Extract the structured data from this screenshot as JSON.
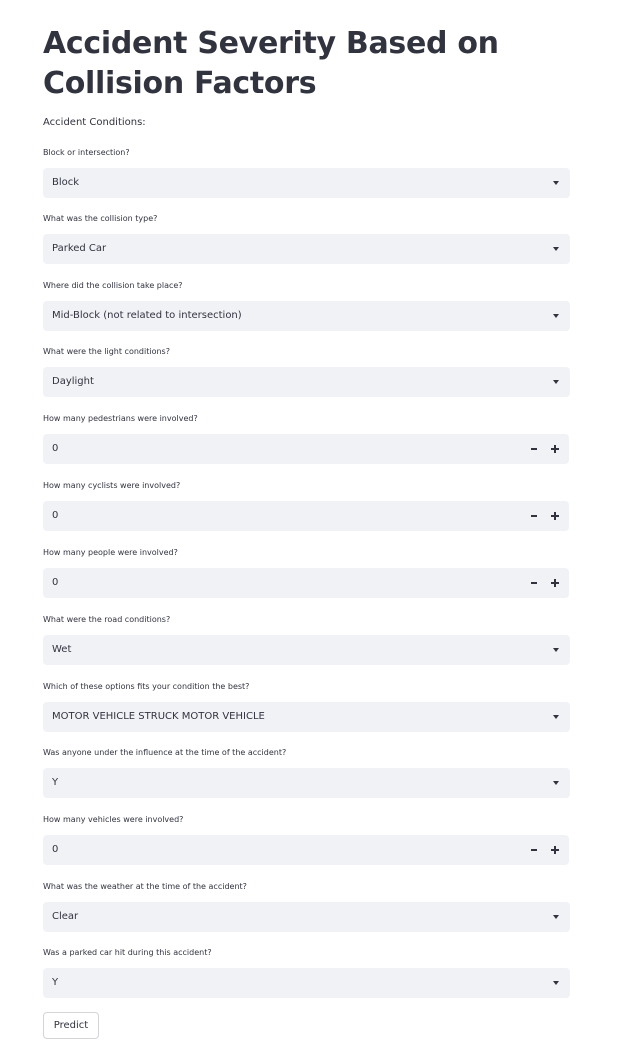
{
  "page": {
    "title": "Accident Severity Based on Collision Factors",
    "subheading": "Accident Conditions:"
  },
  "fields": {
    "block_intersection": {
      "label": "Block or intersection?",
      "value": "Block"
    },
    "collision_type": {
      "label": "What was the collision type?",
      "value": "Parked Car"
    },
    "collision_location": {
      "label": "Where did the collision take place?",
      "value": "Mid-Block (not related to intersection)"
    },
    "light_conditions": {
      "label": "What were the light conditions?",
      "value": "Daylight"
    },
    "pedestrians": {
      "label": "How many pedestrians were involved?",
      "value": "0"
    },
    "cyclists": {
      "label": "How many cyclists were involved?",
      "value": "0"
    },
    "people": {
      "label": "How many people were involved?",
      "value": "0"
    },
    "road_conditions": {
      "label": "What were the road conditions?",
      "value": "Wet"
    },
    "condition_option": {
      "label": "Which of these options fits your condition the best?",
      "value": "MOTOR VEHICLE STRUCK MOTOR VEHICLE"
    },
    "under_influence": {
      "label": "Was anyone under the influence at the time of the accident?",
      "value": "Y"
    },
    "vehicles": {
      "label": "How many vehicles were involved?",
      "value": "0"
    },
    "weather": {
      "label": "What was the weather at the time of the accident?",
      "value": "Clear"
    },
    "parked_car_hit": {
      "label": "Was a parked car hit during this accident?",
      "value": "Y"
    }
  },
  "actions": {
    "predict_label": "Predict"
  },
  "colors": {
    "text": "#31333f",
    "input_background": "#f0f2f6",
    "button_border": "#d3d5da"
  },
  "icons": {
    "select_caret": "chevron-down-icon",
    "decrement": "minus-icon",
    "increment": "plus-icon"
  }
}
